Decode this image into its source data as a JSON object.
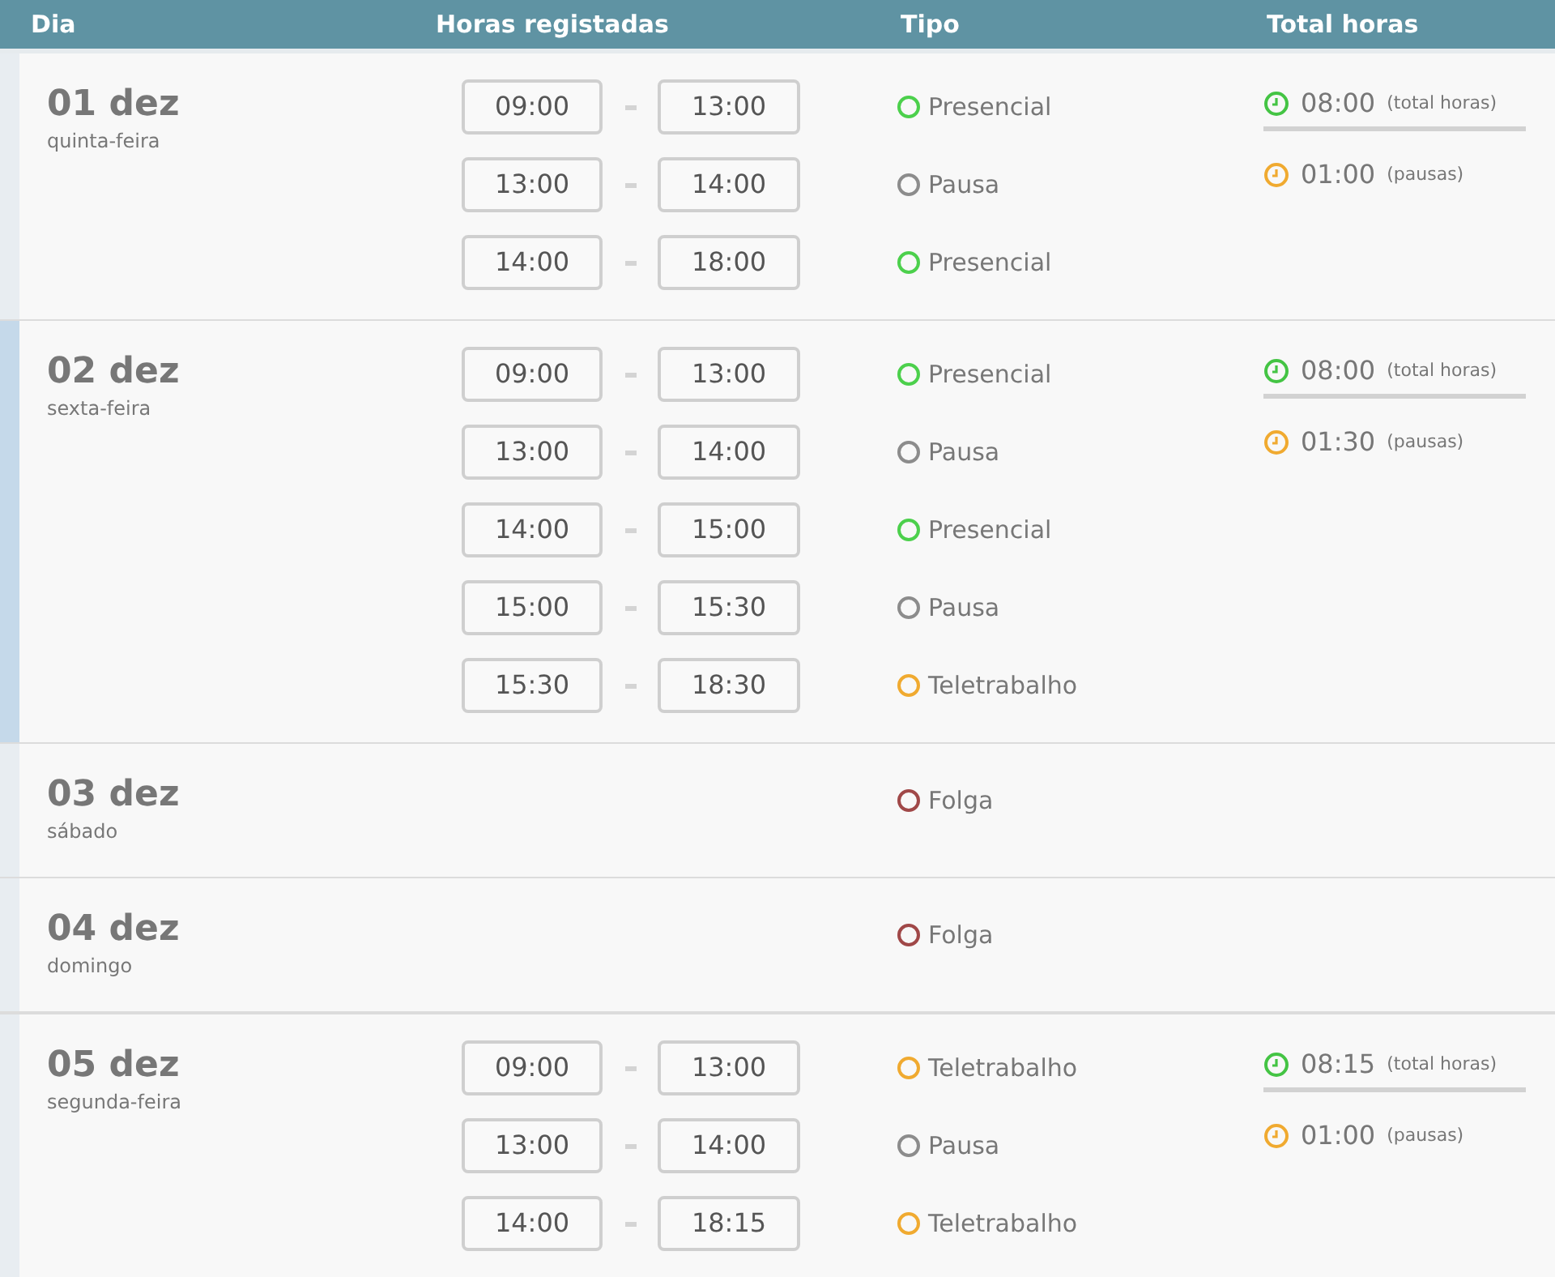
{
  "header": {
    "columns": [
      "Dia",
      "Horas registadas",
      "Tipo",
      "Total horas"
    ]
  },
  "days": [
    {
      "date": "01 dez",
      "weekday": "quinta-feira",
      "selected": false,
      "week_break": false,
      "entries": [
        {
          "start": "09:00",
          "end": "13:00",
          "type": "Presencial",
          "color": "#4cd04c"
        },
        {
          "start": "13:00",
          "end": "14:00",
          "type": "Pausa",
          "color": "#8c8c8c"
        },
        {
          "start": "14:00",
          "end": "18:00",
          "type": "Presencial",
          "color": "#4cd04c"
        }
      ],
      "totals": {
        "total": "08:00",
        "total_label": "(total horas)",
        "pauses": "01:00",
        "pauses_label": "(pausas)"
      }
    },
    {
      "date": "02 dez",
      "weekday": "sexta-feira",
      "selected": true,
      "week_break": false,
      "entries": [
        {
          "start": "09:00",
          "end": "13:00",
          "type": "Presencial",
          "color": "#4cd04c"
        },
        {
          "start": "13:00",
          "end": "14:00",
          "type": "Pausa",
          "color": "#8c8c8c"
        },
        {
          "start": "14:00",
          "end": "15:00",
          "type": "Presencial",
          "color": "#4cd04c"
        },
        {
          "start": "15:00",
          "end": "15:30",
          "type": "Pausa",
          "color": "#8c8c8c"
        },
        {
          "start": "15:30",
          "end": "18:30",
          "type": "Teletrabalho",
          "color": "#f0aa30"
        }
      ],
      "totals": {
        "total": "08:00",
        "total_label": "(total horas)",
        "pauses": "01:30",
        "pauses_label": "(pausas)"
      }
    },
    {
      "date": "03 dez",
      "weekday": "sábado",
      "selected": false,
      "week_break": false,
      "entries": [
        {
          "type": "Folga",
          "color": "#a04848"
        }
      ]
    },
    {
      "date": "04 dez",
      "weekday": "domingo",
      "selected": false,
      "week_break": false,
      "entries": [
        {
          "type": "Folga",
          "color": "#a04848"
        }
      ]
    },
    {
      "date": "05 dez",
      "weekday": "segunda-feira",
      "selected": false,
      "week_break": true,
      "entries": [
        {
          "start": "09:00",
          "end": "13:00",
          "type": "Teletrabalho",
          "color": "#f0aa30"
        },
        {
          "start": "13:00",
          "end": "14:00",
          "type": "Pausa",
          "color": "#8c8c8c"
        },
        {
          "start": "14:00",
          "end": "18:15",
          "type": "Teletrabalho",
          "color": "#f0aa30"
        }
      ],
      "totals": {
        "total": "08:15",
        "total_label": "(total horas)",
        "pauses": "01:00",
        "pauses_label": "(pausas)"
      }
    }
  ]
}
